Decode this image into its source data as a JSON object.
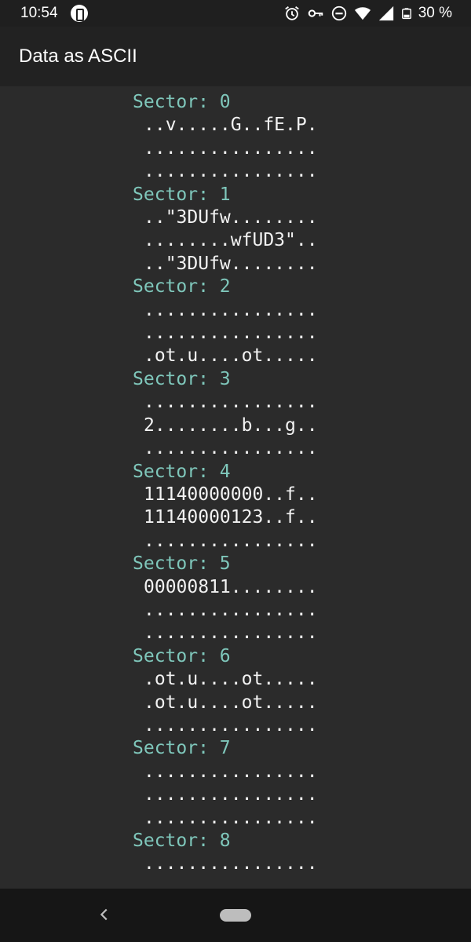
{
  "status_bar": {
    "time": "10:54",
    "battery": "30 %",
    "icons": [
      "app-notification-icon",
      "alarm-icon",
      "vpn-key-icon",
      "do-not-disturb-icon",
      "wifi-icon",
      "signal-icon",
      "battery-icon"
    ]
  },
  "app_bar": {
    "title": "Data as ASCII"
  },
  "sectors": [
    {
      "label": "Sector: 0",
      "lines": [
        "..v.....G..fE.P.",
        "................",
        "................"
      ]
    },
    {
      "label": "Sector: 1",
      "lines": [
        "..\"3DUfw........",
        "........wfUD3\"..",
        "..\"3DUfw........"
      ]
    },
    {
      "label": "Sector: 2",
      "lines": [
        "................",
        "................",
        ".ot.u....ot....."
      ]
    },
    {
      "label": "Sector: 3",
      "lines": [
        "................",
        "2........b...g..",
        "................"
      ]
    },
    {
      "label": "Sector: 4",
      "lines": [
        "11140000000..f..",
        "11140000123..f..",
        "................"
      ]
    },
    {
      "label": "Sector: 5",
      "lines": [
        "00000811........",
        "................",
        "................"
      ]
    },
    {
      "label": "Sector: 6",
      "lines": [
        ".ot.u....ot.....",
        ".ot.u....ot.....",
        "................"
      ]
    },
    {
      "label": "Sector: 7",
      "lines": [
        "................",
        "................",
        "................"
      ]
    },
    {
      "label": "Sector: 8",
      "lines": [
        "................"
      ]
    }
  ],
  "nav_bar": {
    "icons": [
      "back-icon",
      "home-pill-icon"
    ]
  },
  "colors": {
    "background": "#2b2b2b",
    "app_bar": "#222222",
    "sector_header": "#7fc7bb",
    "text": "#f2f2f2"
  }
}
